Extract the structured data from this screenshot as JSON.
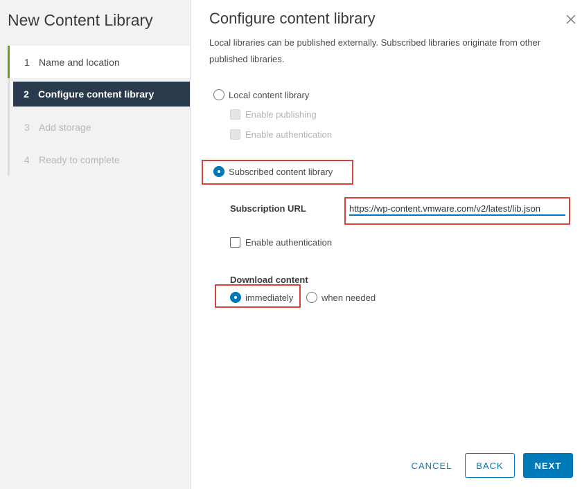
{
  "sidebar": {
    "title": "New Content Library",
    "steps": [
      {
        "num": "1",
        "label": "Name and location"
      },
      {
        "num": "2",
        "label": "Configure content library"
      },
      {
        "num": "3",
        "label": "Add storage"
      },
      {
        "num": "4",
        "label": "Ready to complete"
      }
    ]
  },
  "main": {
    "title": "Configure content library",
    "description": "Local libraries can be published externally. Subscribed libraries originate from other published libraries.",
    "local_library": {
      "label": "Local content library",
      "enable_publishing": "Enable publishing",
      "enable_authentication": "Enable authentication"
    },
    "subscribed_library": {
      "label": "Subscribed content library",
      "url_label": "Subscription URL",
      "url_value": "https://wp-content.vmware.com/v2/latest/lib.json",
      "enable_authentication": "Enable authentication"
    },
    "download": {
      "label": "Download content",
      "immediately": "immediately",
      "when_needed": "when needed"
    }
  },
  "footer": {
    "cancel": "CANCEL",
    "back": "BACK",
    "next": "NEXT"
  },
  "colors": {
    "accent": "#0079b8",
    "highlight": "#d9433b",
    "active_step_bg": "#283a4b",
    "completed_step": "#62a420"
  }
}
